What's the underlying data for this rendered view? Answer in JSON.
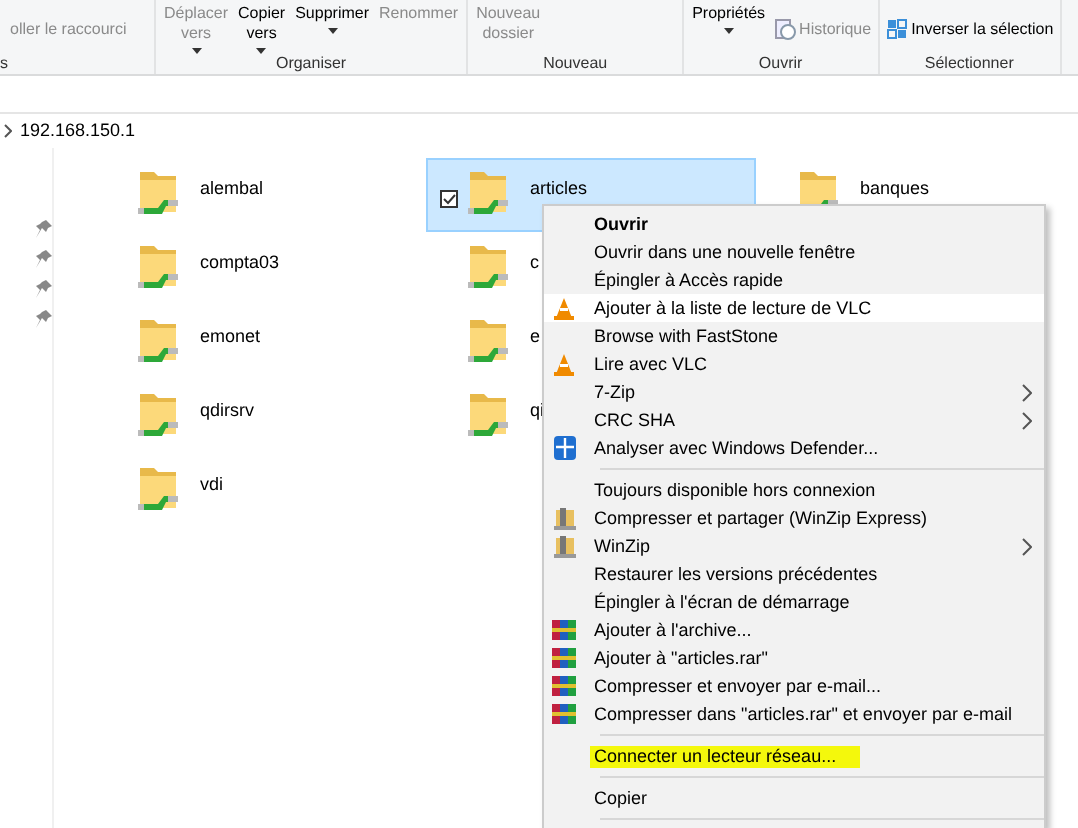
{
  "ribbon": {
    "groups": [
      {
        "label": "s",
        "buttons": [
          {
            "label": "oller le raccourci",
            "kind": "small",
            "disabled": true,
            "dropdown": false
          }
        ]
      },
      {
        "label": "Organiser",
        "buttons": [
          {
            "label": "Déplacer vers",
            "kind": "large",
            "disabled": true,
            "dropdown": true
          },
          {
            "label": "Copier vers",
            "kind": "large",
            "disabled": false,
            "dropdown": true
          },
          {
            "label": "Supprimer",
            "kind": "large",
            "disabled": false,
            "dropdown": true
          },
          {
            "label": "Renommer",
            "kind": "large",
            "disabled": true,
            "dropdown": false
          }
        ]
      },
      {
        "label": "Nouveau",
        "buttons": [
          {
            "label": "Nouveau dossier",
            "kind": "large",
            "disabled": true,
            "dropdown": false
          }
        ]
      },
      {
        "label": "Ouvrir",
        "buttons": [
          {
            "label": "Propriétés",
            "kind": "large",
            "disabled": false,
            "dropdown": true
          },
          {
            "label": "Historique",
            "kind": "history",
            "disabled": true,
            "dropdown": false
          }
        ]
      },
      {
        "label": "Sélectionner",
        "buttons": [
          {
            "label": "Inverser la sélection",
            "kind": "invert",
            "disabled": false,
            "dropdown": false
          }
        ]
      }
    ]
  },
  "address": {
    "path": "192.168.150.1"
  },
  "folders": [
    [
      {
        "name": "alembal",
        "selected": false,
        "checked": false
      },
      {
        "name": "compta03",
        "selected": false,
        "checked": false
      },
      {
        "name": "emonet",
        "selected": false,
        "checked": false
      },
      {
        "name": "qdirsrv",
        "selected": false,
        "checked": false
      },
      {
        "name": "vdi",
        "selected": false,
        "checked": false
      }
    ],
    [
      {
        "name": "articles",
        "selected": true,
        "checked": true
      },
      {
        "name": "c",
        "selected": false,
        "checked": false
      },
      {
        "name": "e",
        "selected": false,
        "checked": false
      },
      {
        "name": "qi",
        "selected": false,
        "checked": false
      }
    ],
    [
      {
        "name": "banques",
        "selected": false,
        "checked": false
      }
    ]
  ],
  "context_menu": [
    {
      "kind": "plain",
      "label": "Ouvrir",
      "bold": true,
      "hovered": false,
      "submenu": false,
      "highlighted": false
    },
    {
      "kind": "plain",
      "label": "Ouvrir dans une nouvelle fenêtre",
      "bold": false,
      "hovered": false,
      "submenu": false,
      "highlighted": false
    },
    {
      "kind": "plain",
      "label": "Épingler à Accès rapide",
      "bold": false,
      "hovered": false,
      "submenu": false,
      "highlighted": false
    },
    {
      "kind": "cone",
      "label": "Ajouter à la liste de lecture de VLC",
      "bold": false,
      "hovered": true,
      "submenu": false,
      "highlighted": false
    },
    {
      "kind": "plain",
      "label": "Browse with FastStone",
      "bold": false,
      "hovered": false,
      "submenu": false,
      "highlighted": false
    },
    {
      "kind": "cone",
      "label": "Lire avec VLC",
      "bold": false,
      "hovered": false,
      "submenu": false,
      "highlighted": false
    },
    {
      "kind": "plain",
      "label": "7-Zip",
      "bold": false,
      "hovered": false,
      "submenu": true,
      "highlighted": false
    },
    {
      "kind": "plain",
      "label": "CRC SHA",
      "bold": false,
      "hovered": false,
      "submenu": true,
      "highlighted": false
    },
    {
      "kind": "shield",
      "label": "Analyser avec Windows Defender...",
      "bold": false,
      "hovered": false,
      "submenu": false,
      "highlighted": false
    },
    {
      "kind": "separator"
    },
    {
      "kind": "plain",
      "label": "Toujours disponible hors connexion",
      "bold": false,
      "hovered": false,
      "submenu": false,
      "highlighted": false
    },
    {
      "kind": "vise",
      "label": "Compresser et partager (WinZip Express)",
      "bold": false,
      "hovered": false,
      "submenu": false,
      "highlighted": false
    },
    {
      "kind": "vise",
      "label": "WinZip",
      "bold": false,
      "hovered": false,
      "submenu": true,
      "highlighted": false
    },
    {
      "kind": "plain",
      "label": "Restaurer les versions précédentes",
      "bold": false,
      "hovered": false,
      "submenu": false,
      "highlighted": false
    },
    {
      "kind": "plain",
      "label": "Épingler à l'écran de démarrage",
      "bold": false,
      "hovered": false,
      "submenu": false,
      "highlighted": false
    },
    {
      "kind": "books",
      "label": "Ajouter à l'archive...",
      "bold": false,
      "hovered": false,
      "submenu": false,
      "highlighted": false
    },
    {
      "kind": "books",
      "label": "Ajouter à \"articles.rar\"",
      "bold": false,
      "hovered": false,
      "submenu": false,
      "highlighted": false
    },
    {
      "kind": "books",
      "label": "Compresser et envoyer par e-mail...",
      "bold": false,
      "hovered": false,
      "submenu": false,
      "highlighted": false
    },
    {
      "kind": "books",
      "label": "Compresser dans \"articles.rar\" et envoyer par e-mail",
      "bold": false,
      "hovered": false,
      "submenu": false,
      "highlighted": false
    },
    {
      "kind": "separator"
    },
    {
      "kind": "plain",
      "label": "Connecter un lecteur réseau...",
      "bold": false,
      "hovered": false,
      "submenu": false,
      "highlighted": true
    },
    {
      "kind": "separator"
    },
    {
      "kind": "plain",
      "label": "Copier",
      "bold": false,
      "hovered": false,
      "submenu": false,
      "highlighted": false
    },
    {
      "kind": "separator"
    }
  ]
}
